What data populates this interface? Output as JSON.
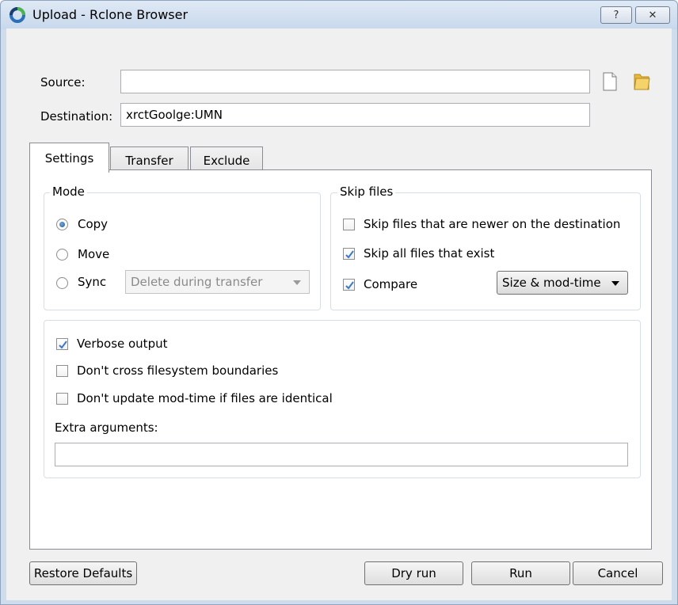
{
  "window": {
    "title": "Upload - Rclone Browser",
    "help_label": "?",
    "close_label": "✕"
  },
  "form": {
    "source_label": "Source:",
    "source_value": "",
    "destination_label": "Destination:",
    "destination_value": "xrctGoolge:UMN"
  },
  "tabs": [
    {
      "label": "Settings",
      "active": true
    },
    {
      "label": "Transfer",
      "active": false
    },
    {
      "label": "Exclude",
      "active": false
    }
  ],
  "mode": {
    "title": "Mode",
    "copy_label": "Copy",
    "move_label": "Move",
    "sync_label": "Sync",
    "selected": "Copy",
    "sync_option": "Delete during transfer"
  },
  "skip": {
    "title": "Skip files",
    "newer_label": "Skip files that are newer on the destination",
    "newer_checked": false,
    "exist_label": "Skip all files that exist",
    "exist_checked": true,
    "compare_label": "Compare",
    "compare_checked": true,
    "compare_option": "Size & mod-time"
  },
  "options": {
    "verbose_label": "Verbose output",
    "verbose_checked": true,
    "nocross_label": "Don't cross filesystem boundaries",
    "nocross_checked": false,
    "noupdate_label": "Don't update mod-time if files are identical",
    "noupdate_checked": false,
    "extra_label": "Extra arguments:",
    "extra_value": ""
  },
  "buttons": {
    "restore_label": "Restore Defaults",
    "dryrun_label": "Dry run",
    "run_label": "Run",
    "cancel_label": "Cancel"
  },
  "colors": {
    "accent": "#3c78c8",
    "folder": "#e8b83a"
  }
}
